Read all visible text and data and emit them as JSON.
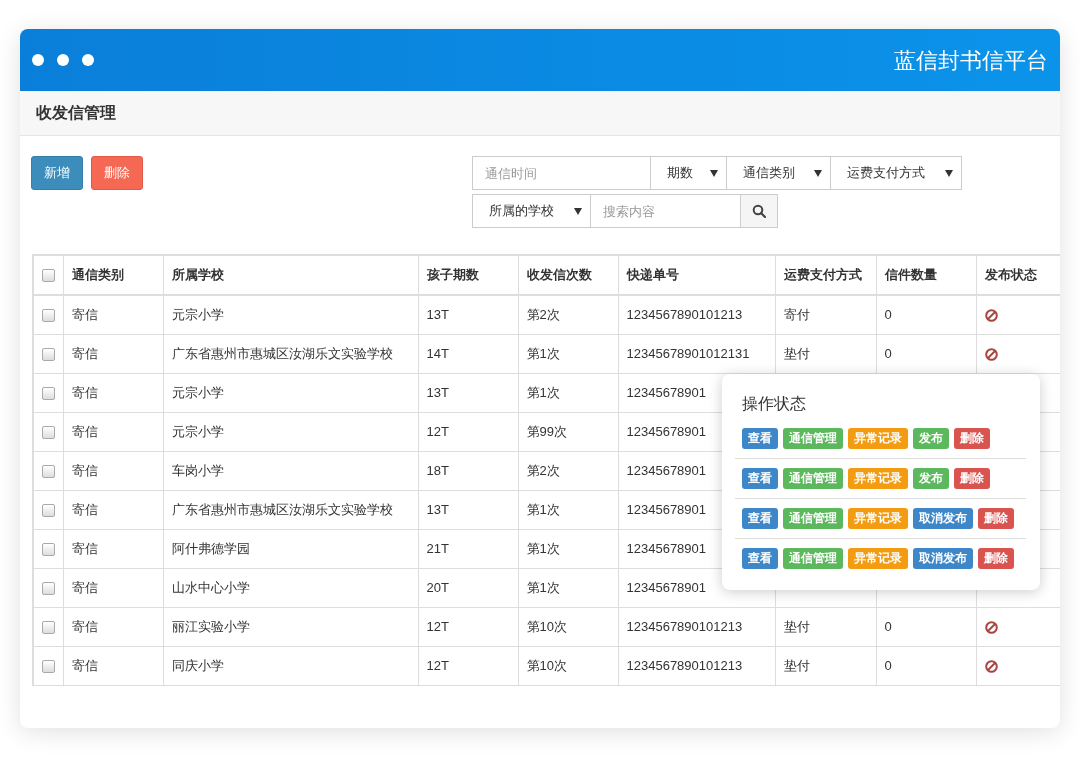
{
  "app": {
    "title": "蓝信封书信平台"
  },
  "section": {
    "title": "收发信管理"
  },
  "toolbar": {
    "buttons": [
      {
        "label": "新增",
        "kind": "primary"
      },
      {
        "label": "删除",
        "kind": "danger"
      }
    ]
  },
  "filters": [
    {
      "kind": "input",
      "placeholder": "通信时间"
    },
    {
      "kind": "select",
      "label": "期数"
    },
    {
      "kind": "select",
      "label": "通信类别"
    },
    {
      "kind": "select",
      "label": "运费支付方式"
    },
    {
      "kind": "select",
      "label": "所属的学校"
    },
    {
      "kind": "input",
      "placeholder": "搜索内容"
    },
    {
      "kind": "search"
    }
  ],
  "table": {
    "header_checked": false,
    "columns": [
      "通信类别",
      "所属学校",
      "孩子期数",
      "收发信次数",
      "快递单号",
      "运费支付方式",
      "信件数量",
      "发布状态"
    ],
    "rows": [
      {
        "checked": false,
        "cells": [
          "寄信",
          "元宗小学",
          "13T",
          "第2次",
          "1234567890101213",
          "寄付",
          "0"
        ],
        "published": false
      },
      {
        "checked": false,
        "cells": [
          "寄信",
          "广东省惠州市惠城区汝湖乐文实验学校",
          "14T",
          "第1次",
          "12345678901012131",
          "垫付",
          "0"
        ],
        "published": false
      },
      {
        "checked": false,
        "cells": [
          "寄信",
          "元宗小学",
          "13T",
          "第1次",
          "12345678901"
        ]
      },
      {
        "checked": false,
        "cells": [
          "寄信",
          "元宗小学",
          "12T",
          "第99次",
          "12345678901"
        ]
      },
      {
        "checked": false,
        "cells": [
          "寄信",
          "车岗小学",
          "18T",
          "第2次",
          "12345678901"
        ]
      },
      {
        "checked": false,
        "cells": [
          "寄信",
          "广东省惠州市惠城区汝湖乐文实验学校",
          "13T",
          "第1次",
          "12345678901"
        ]
      },
      {
        "checked": false,
        "cells": [
          "寄信",
          "阿什弗德学园",
          "21T",
          "第1次",
          "12345678901"
        ]
      },
      {
        "checked": false,
        "cells": [
          "寄信",
          "山水中心小学",
          "20T",
          "第1次",
          "12345678901"
        ]
      },
      {
        "checked": false,
        "cells": [
          "寄信",
          "丽江实验小学",
          "12T",
          "第10次",
          "1234567890101213",
          "垫付",
          "0"
        ],
        "published": false
      },
      {
        "checked": false,
        "cells": [
          "寄信",
          "同庆小学",
          "12T",
          "第10次",
          "1234567890101213",
          "垫付",
          "0"
        ],
        "published": false
      }
    ]
  },
  "popover": {
    "title": "操作状态",
    "rows": [
      [
        {
          "label": "查看",
          "kind": "view"
        },
        {
          "label": "通信管理",
          "kind": "manage"
        },
        {
          "label": "异常记录",
          "kind": "exception"
        },
        {
          "label": "发布",
          "kind": "publish"
        },
        {
          "label": "删除",
          "kind": "delete"
        }
      ],
      [
        {
          "label": "查看",
          "kind": "view"
        },
        {
          "label": "通信管理",
          "kind": "manage"
        },
        {
          "label": "异常记录",
          "kind": "exception"
        },
        {
          "label": "发布",
          "kind": "publish"
        },
        {
          "label": "删除",
          "kind": "delete"
        }
      ],
      [
        {
          "label": "查看",
          "kind": "view"
        },
        {
          "label": "通信管理",
          "kind": "manage"
        },
        {
          "label": "异常记录",
          "kind": "exception"
        },
        {
          "label": "取消发布",
          "kind": "unpublish"
        },
        {
          "label": "删除",
          "kind": "delete"
        }
      ],
      [
        {
          "label": "查看",
          "kind": "view"
        },
        {
          "label": "通信管理",
          "kind": "manage"
        },
        {
          "label": "异常记录",
          "kind": "exception"
        },
        {
          "label": "取消发布",
          "kind": "unpublish"
        },
        {
          "label": "删除",
          "kind": "delete"
        }
      ]
    ]
  }
}
